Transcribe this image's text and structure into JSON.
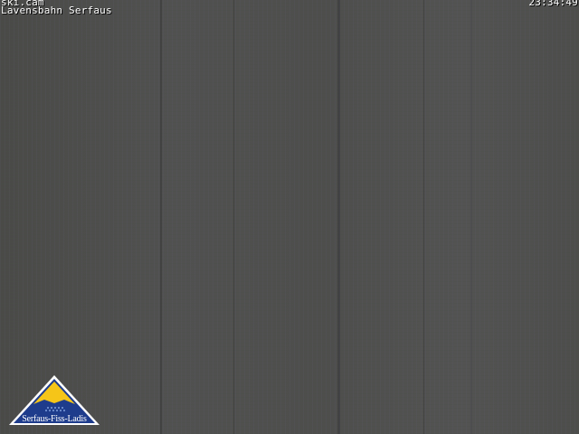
{
  "overlay": {
    "site": "ski.cam",
    "location": "Lavensbahn Serfaus",
    "time": "23:34:49"
  },
  "logo": {
    "text": "Serfaus-Fiss-Ladis",
    "colors": {
      "triangle": "#1e3c8c",
      "peak": "#f5c518",
      "dots": "#6f8fd0"
    }
  },
  "image": {
    "description_color": "#4f4f4c"
  }
}
